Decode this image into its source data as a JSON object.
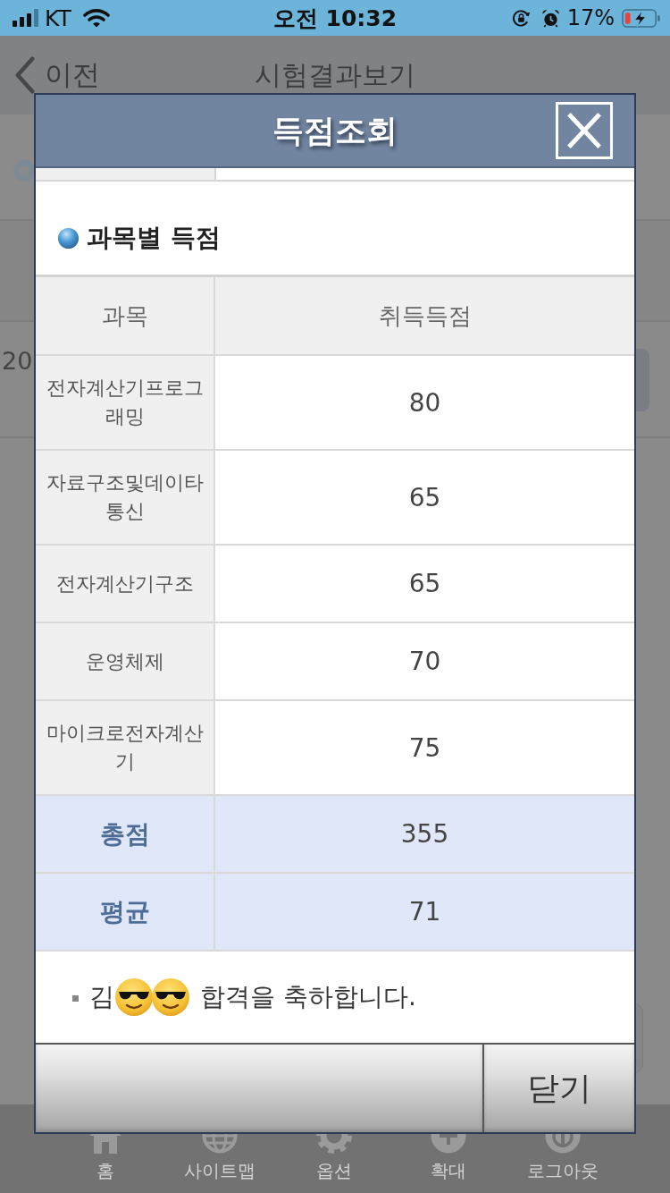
{
  "status_bar": {
    "carrier": "KT",
    "time": "오전 10:32",
    "battery": "17%"
  },
  "background": {
    "header": {
      "back": "이전",
      "title": "시험결과보기"
    },
    "row_text": "20",
    "tab_bar": [
      {
        "label": "홈",
        "kind": "home"
      },
      {
        "label": "사이트맵",
        "kind": "globe"
      },
      {
        "label": "옵션",
        "kind": "gear"
      },
      {
        "label": "확대",
        "kind": "zoom"
      },
      {
        "label": "로그아웃",
        "kind": "power"
      }
    ]
  },
  "dialog": {
    "title": "득점조회",
    "section_title": "과목별 득점",
    "table": {
      "columns": [
        "과목",
        "취득득점"
      ],
      "rows": [
        {
          "subject": "전자계산기프로그래밍",
          "score": "80"
        },
        {
          "subject": "자료구조및데이타통신",
          "score": "65"
        },
        {
          "subject": "전자계산기구조",
          "score": "65"
        },
        {
          "subject": "운영체제",
          "score": "70"
        },
        {
          "subject": "마이크로전자계산기",
          "score": "75"
        }
      ],
      "summary_rows": [
        {
          "label": "총점",
          "value": "355"
        },
        {
          "label": "평균",
          "value": "71"
        }
      ]
    },
    "message": {
      "name_start": "김",
      "stickers": [
        {
          "kind": "sunglasses"
        },
        {
          "kind": "sunglasses"
        }
      ],
      "text": "합격을 축하합니다."
    },
    "buttons": [
      "닫기"
    ]
  }
}
